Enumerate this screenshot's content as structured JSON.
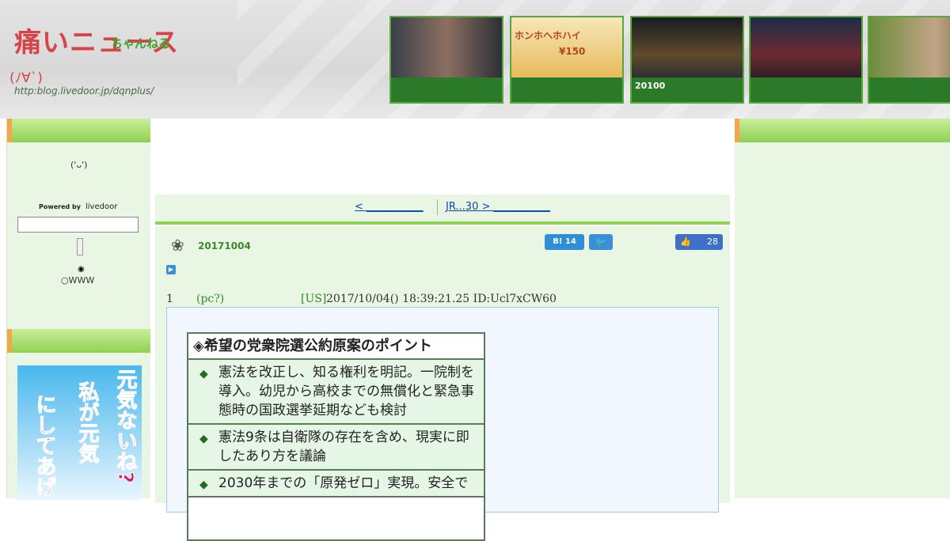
{
  "header": {
    "logo": {
      "title": "痛いニュース",
      "sub": "ちゃんねる",
      "kaomoji": "(ﾉ∀`)",
      "url": "http:blog.livedoor.jp/dqnplus/"
    },
    "thumbs": [
      {
        "caption": ""
      },
      {
        "caption": "ホンホヘホハイ",
        "price": "¥150"
      },
      {
        "caption": "20100"
      },
      {
        "caption": ""
      },
      {
        "caption": ""
      }
    ]
  },
  "sidebar": {
    "kaomoji": "('ᴗ')",
    "powered_by": "Powered by",
    "brand": "livedoor",
    "search": {
      "placeholder": "",
      "value": ""
    },
    "radio_www": "WWW",
    "banner": {
      "line1": "元気ないね?",
      "line2": "私が元気",
      "line3": "にしてあげ"
    }
  },
  "nav": {
    "prev": "< ___________",
    "next": "JR...30 > ___________"
  },
  "post": {
    "date": "20171004",
    "hatena": {
      "label": "B!",
      "count": "14"
    },
    "facebook": {
      "count": "28"
    },
    "res": {
      "num": "1",
      "name": "(pc?)",
      "country": "[US]",
      "meta": "2017/10/04() 18:39:21.25 ID:Ucl7xCW60"
    },
    "card": {
      "title": "希望の党衆院選公約原案のポイント",
      "items": [
        "憲法を改正し、知る権利を明記。一院制を導入。幼児から高校までの無償化と緊急事態時の国政選挙延期なども検討",
        "憲法9条は自衛隊の存在を含め、現実に即したあり方を議論",
        "2030年までの「原発ゼロ」実現。安全で"
      ]
    }
  },
  "colors": {
    "accent_green": "#8fd152",
    "orange": "#f3a64b",
    "sidebar_bg": "#e9f6e3",
    "link": "#0645ad"
  }
}
